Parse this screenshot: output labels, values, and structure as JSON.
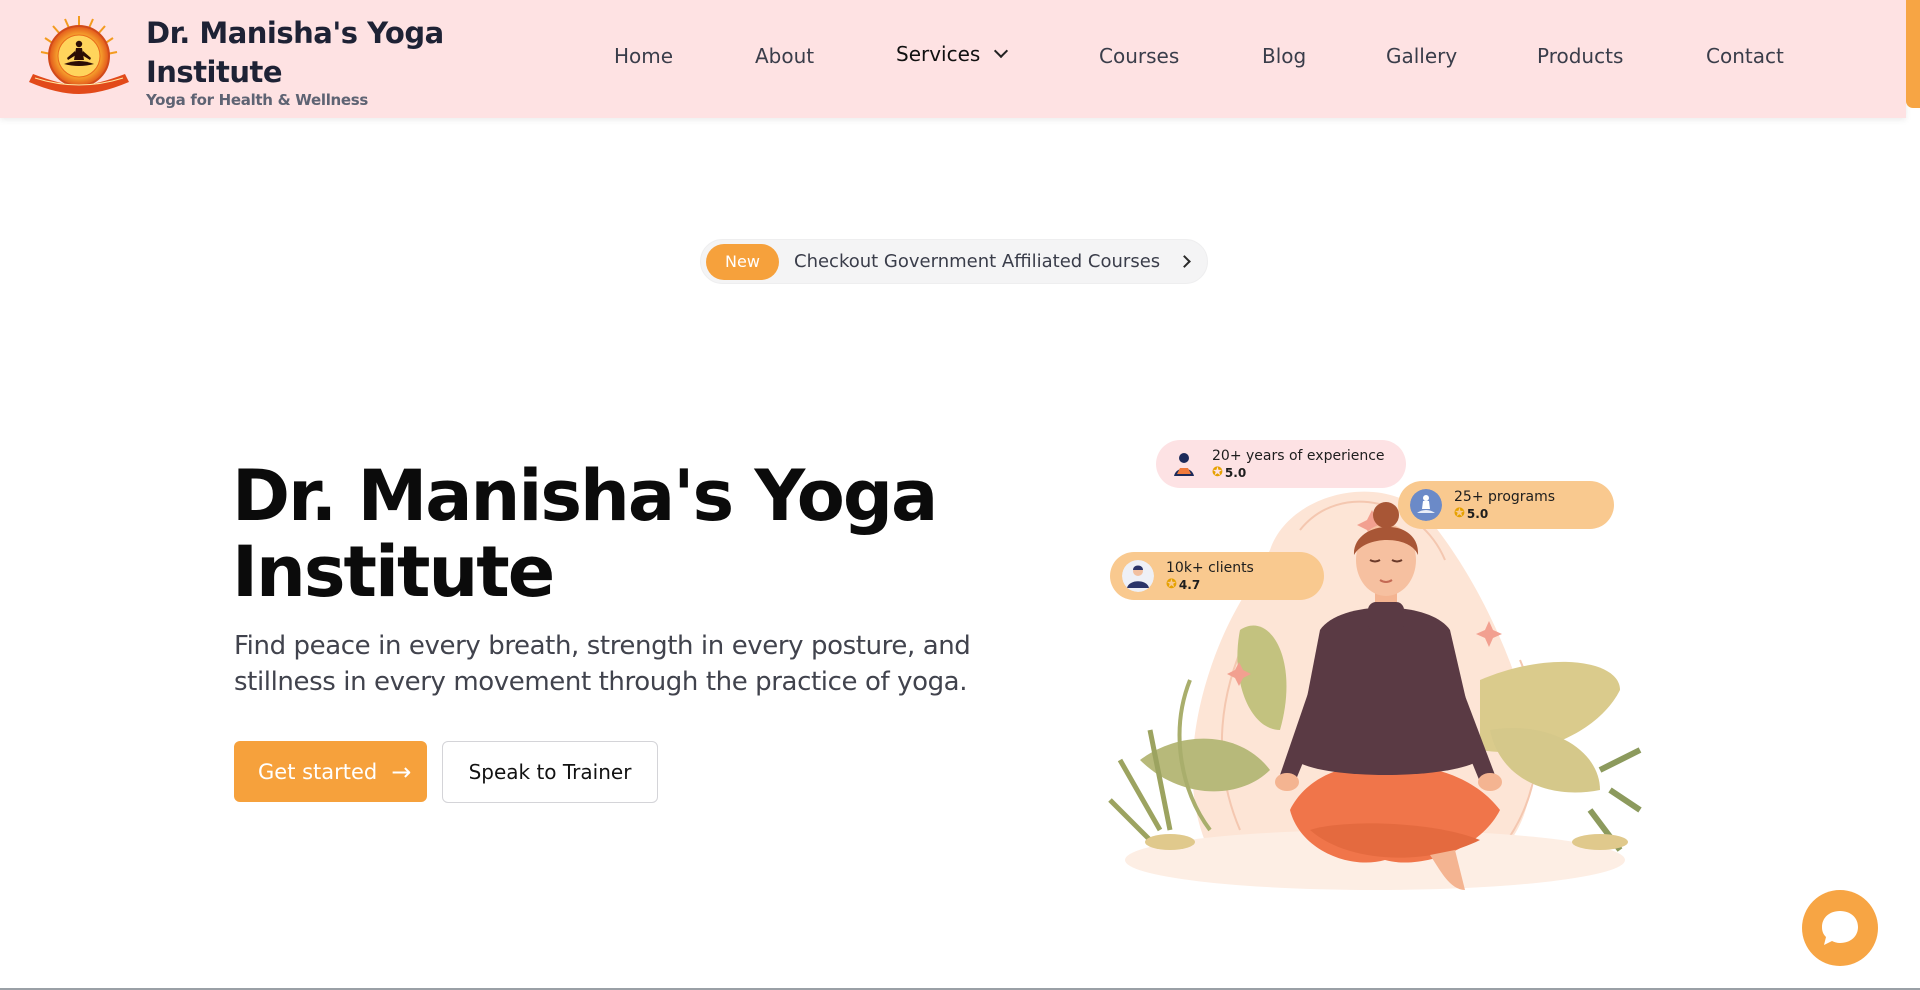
{
  "brand": {
    "title": "Dr. Manisha's Yoga Institute",
    "tagline": "Yoga for Health & Wellness"
  },
  "nav": {
    "items": [
      {
        "label": "Home"
      },
      {
        "label": "About"
      },
      {
        "label": "Services"
      },
      {
        "label": "Courses"
      },
      {
        "label": "Blog"
      },
      {
        "label": "Gallery"
      },
      {
        "label": "Products"
      },
      {
        "label": "Contact"
      }
    ]
  },
  "announcement": {
    "badge": "New",
    "text": "Checkout Government Affiliated Courses"
  },
  "hero": {
    "title": "Dr. Manisha's Yoga Institute",
    "subtitle": "Find peace in every breath, strength in every posture, and stillness in every movement through the practice of yoga.",
    "primary_button": "Get started",
    "secondary_button": "Speak to Trainer"
  },
  "stats": [
    {
      "label": "20+ years of experience",
      "rating": "5.0",
      "color": "#fde2e4"
    },
    {
      "label": "25+ programs",
      "rating": "5.0",
      "color": "#f9c98f"
    },
    {
      "label": "10k+ clients",
      "rating": "4.7",
      "color": "#f9c98f"
    }
  ],
  "colors": {
    "accent": "#f6a13c",
    "nav_bg": "#fee2e3"
  },
  "icons": {
    "announce_arrow": "chevron-right-icon",
    "services_dropdown": "chevron-down-icon",
    "cta_arrow": "arrow-right-icon",
    "chat": "chat-bubble-icon"
  }
}
